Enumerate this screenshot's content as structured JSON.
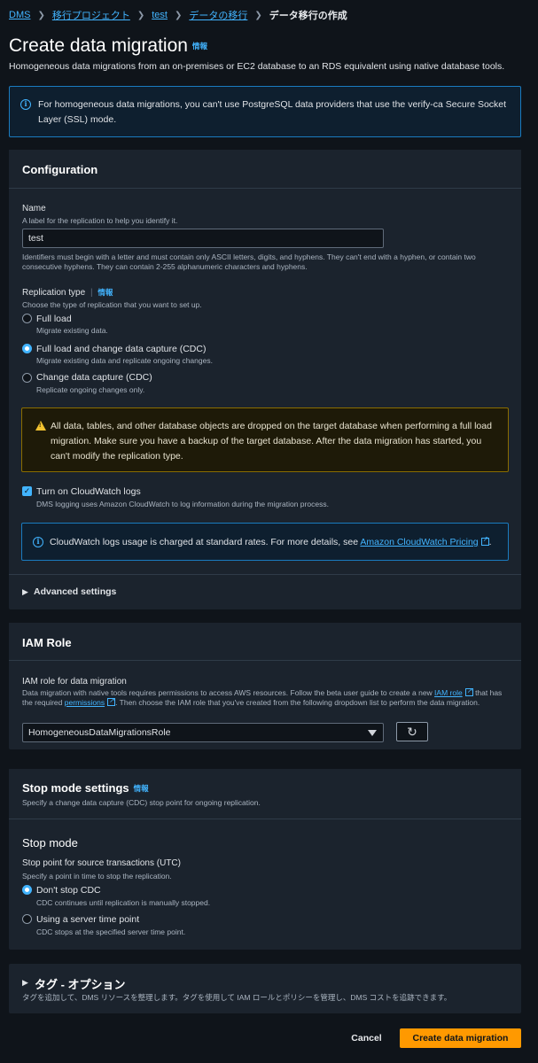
{
  "breadcrumb": {
    "items": [
      "DMS",
      "移行プロジェクト",
      "test",
      "データの移行"
    ],
    "current": "データ移行の作成"
  },
  "header": {
    "title": "Create data migration",
    "info": "情報",
    "description": "Homogeneous data migrations from an on-premises or EC2 database to an RDS equivalent using native database tools."
  },
  "ssl_banner": {
    "text": "For homogeneous data migrations, you can't use PostgreSQL data providers that use the verify-ca Secure Socket Layer (SSL) mode."
  },
  "configuration": {
    "title": "Configuration",
    "name": {
      "label": "Name",
      "description": "A label for the replication to help you identify it.",
      "value": "test",
      "constraints": "Identifiers must begin with a letter and must contain only ASCII letters, digits, and hyphens. They can't end with a hyphen, or contain two consecutive hyphens. They can contain 2-255 alphanumeric characters and hyphens."
    },
    "replication_type": {
      "label": "Replication type",
      "info": "情報",
      "description": "Choose the type of replication that you want to set up.",
      "options": [
        {
          "label": "Full load",
          "description": "Migrate existing data.",
          "selected": false
        },
        {
          "label": "Full load and change data capture (CDC)",
          "description": "Migrate existing data and replicate ongoing changes.",
          "selected": true
        },
        {
          "label": "Change data capture (CDC)",
          "description": "Replicate ongoing changes only.",
          "selected": false
        }
      ]
    },
    "warning": "All data, tables, and other database objects are dropped on the target database when performing a full load migration. Make sure you have a backup of the target database. After the data migration has started, you can't modify the replication type.",
    "cloudwatch": {
      "label": "Turn on CloudWatch logs",
      "checked": true,
      "description": "DMS logging uses Amazon CloudWatch to log information during the migration process.",
      "banner_text": "CloudWatch logs usage is charged at standard rates. For more details, see ",
      "banner_link": "Amazon CloudWatch Pricing",
      "banner_end": "."
    },
    "advanced": "Advanced settings"
  },
  "iam": {
    "title": "IAM Role",
    "label": "IAM role for data migration",
    "desc_1": "Data migration with native tools requires permissions to access AWS resources. Follow the beta user guide to create a new ",
    "link_role": "IAM role",
    "desc_2": " that has the required ",
    "link_permissions": "permissions",
    "desc_3": ". Then choose the IAM role that you've created from the following dropdown list to perform the data migration.",
    "selected": "HomogeneousDataMigrationsRole"
  },
  "stop_mode": {
    "title": "Stop mode settings",
    "info": "情報",
    "description": "Specify a change data capture (CDC) stop point for ongoing replication.",
    "subtitle": "Stop mode",
    "label": "Stop point for source transactions (UTC)",
    "label_desc": "Specify a point in time to stop the replication.",
    "options": [
      {
        "label": "Don't stop CDC",
        "description": "CDC continues until replication is manually stopped.",
        "selected": true
      },
      {
        "label": "Using a server time point",
        "description": "CDC stops at the specified server time point.",
        "selected": false
      }
    ]
  },
  "tags": {
    "title": "タグ - オプション",
    "description": "タグを追加して、DMS リソースを整理します。タグを使用して IAM ロールとポリシーを管理し、DMS コストを追跡できます。"
  },
  "footer": {
    "cancel": "Cancel",
    "submit": "Create data migration"
  },
  "colors": {
    "background": "#0f141a",
    "panel": "#1b232d",
    "link": "#42b4ff",
    "primary": "#ff9900",
    "warning_border": "#8a6d00"
  }
}
